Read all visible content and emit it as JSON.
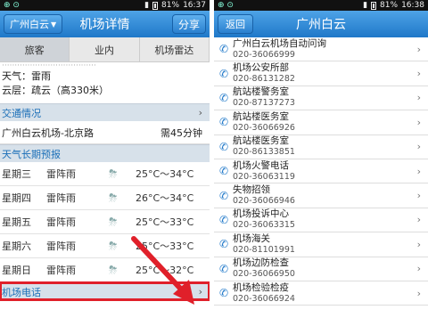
{
  "left_status": {
    "time": "16:37",
    "battery": "81%",
    "notif": "⊕ ⊙"
  },
  "right_status": {
    "time": "16:38",
    "battery": "81%",
    "notif": "⊕ ⊙"
  },
  "left_header": {
    "dropdown_label": "广州白云",
    "title": "机场详情",
    "share_label": "分享"
  },
  "tabs": [
    "旅客",
    "业内",
    "机场雷达"
  ],
  "weather": {
    "cut_line": "·····································",
    "line1": "天气：雷雨",
    "line2": "云层：疏云（高330米）"
  },
  "traffic": {
    "header": "交通情况",
    "route": "广州白云机场-北京路",
    "duration": "需45分钟"
  },
  "forecast": {
    "header": "天气长期预报",
    "rows": [
      {
        "day": "星期三",
        "cond": "雷阵雨",
        "temp": "25°C～34°C"
      },
      {
        "day": "星期四",
        "cond": "雷阵雨",
        "temp": "26°C～34°C"
      },
      {
        "day": "星期五",
        "cond": "雷阵雨",
        "temp": "25°C～33°C"
      },
      {
        "day": "星期六",
        "cond": "雷阵雨",
        "temp": "25°C～33°C"
      },
      {
        "day": "星期日",
        "cond": "雷阵雨",
        "temp": "25°C～32°C"
      }
    ]
  },
  "airport_phone": {
    "header": "机场电话"
  },
  "right_header": {
    "back_label": "返回",
    "title": "广州白云"
  },
  "phones": [
    {
      "name": "广州白云机场自动问询",
      "number": "020-36066999"
    },
    {
      "name": "机场公安所部",
      "number": "020-86131282"
    },
    {
      "name": "航站楼警务室",
      "number": "020-87137273"
    },
    {
      "name": "航站楼医务室",
      "number": "020-36066926"
    },
    {
      "name": "航站楼医务室",
      "number": "020-86133851"
    },
    {
      "name": "机场火警电话",
      "number": "020-36063119"
    },
    {
      "name": "失物招领",
      "number": "020-36066946"
    },
    {
      "name": "机场投诉中心",
      "number": "020-36063315"
    },
    {
      "name": "机场海关",
      "number": "020-81101991"
    },
    {
      "name": "机场边防检查",
      "number": "020-36066950"
    },
    {
      "name": "机场检验检疫",
      "number": "020-36066924"
    }
  ],
  "colors": {
    "accent": "#1f78c9",
    "section_bg": "#d7e1ea",
    "highlight": "#e0202a"
  },
  "icons": {
    "phone": "phone-icon",
    "chevron": "chevron-right-icon",
    "weather": "thunderstorm-icon"
  }
}
